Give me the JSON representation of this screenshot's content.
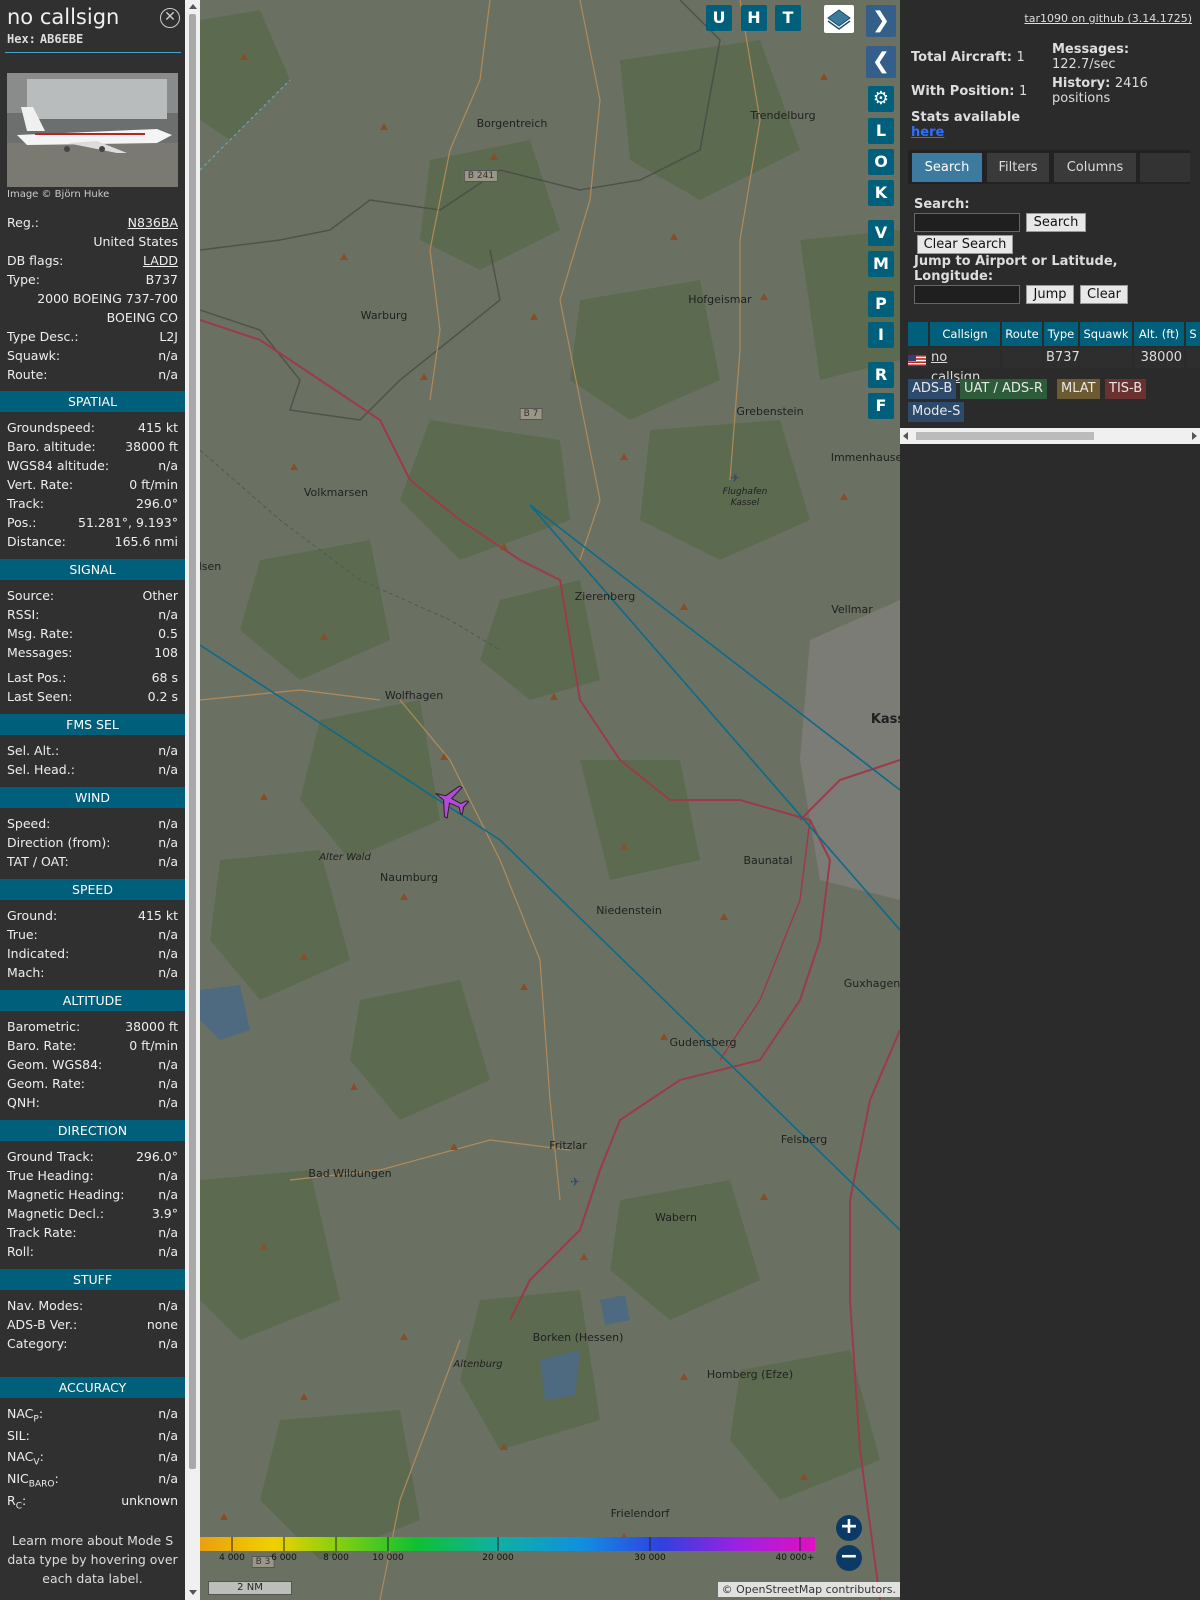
{
  "aircraft": {
    "callsign": "no callsign",
    "hex_label": "Hex:",
    "hex": "AB6EBE",
    "image_credit": "Image © Björn Huke",
    "close_icon": "close-icon"
  },
  "details": {
    "reg_label": "Reg.:",
    "reg": "N836BA",
    "country": "United States",
    "dbflags_label": "DB flags:",
    "dbflags": "LADD",
    "type_label": "Type:",
    "type": "B737",
    "type_full": "2000 BOEING 737-700",
    "manufacturer": "BOEING CO",
    "typedesc_label": "Type Desc.:",
    "typedesc": "L2J",
    "squawk_label": "Squawk:",
    "squawk": "n/a",
    "route_label": "Route:",
    "route": "n/a"
  },
  "sections": {
    "spatial": "SPATIAL",
    "signal": "SIGNAL",
    "fms": "FMS SEL",
    "wind": "WIND",
    "speed": "SPEED",
    "altitude": "ALTITUDE",
    "direction": "DIRECTION",
    "stuff": "STUFF",
    "accuracy": "ACCURACY"
  },
  "spatial": {
    "gs_label": "Groundspeed:",
    "gs": "415 kt",
    "baro_label": "Baro. altitude:",
    "baro": "38000 ft",
    "wgs_label": "WGS84 altitude:",
    "wgs": "n/a",
    "vr_label": "Vert. Rate:",
    "vr": "0 ft/min",
    "track_label": "Track:",
    "track": "296.0°",
    "pos_label": "Pos.:",
    "pos": "51.281°, 9.193°",
    "dist_label": "Distance:",
    "dist": "165.6 nmi"
  },
  "signal": {
    "source_label": "Source:",
    "source": "Other",
    "rssi_label": "RSSI:",
    "rssi": "n/a",
    "msgrate_label": "Msg. Rate:",
    "msgrate": "0.5",
    "messages_label": "Messages:",
    "messages": "108",
    "lastpos_label": "Last Pos.:",
    "lastpos": "68 s",
    "lastseen_label": "Last Seen:",
    "lastseen": "0.2 s"
  },
  "fms": {
    "selalt_label": "Sel. Alt.:",
    "selalt": "n/a",
    "selhead_label": "Sel. Head.:",
    "selhead": "n/a"
  },
  "wind": {
    "speed_label": "Speed:",
    "speed": "n/a",
    "dir_label": "Direction (from):",
    "dir": "n/a",
    "tat_label": "TAT / OAT:",
    "tat": "n/a"
  },
  "speed": {
    "ground_label": "Ground:",
    "ground": "415 kt",
    "true_label": "True:",
    "true": "n/a",
    "ind_label": "Indicated:",
    "ind": "n/a",
    "mach_label": "Mach:",
    "mach": "n/a"
  },
  "altitude": {
    "baro_label": "Barometric:",
    "baro": "38000 ft",
    "rate_label": "Baro. Rate:",
    "rate": "0 ft/min",
    "geom_label": "Geom. WGS84:",
    "geom": "n/a",
    "georate_label": "Geom. Rate:",
    "georate": "n/a",
    "qnh_label": "QNH:",
    "qnh": "n/a"
  },
  "direction": {
    "gt_label": "Ground Track:",
    "gt": "296.0°",
    "th_label": "True Heading:",
    "th": "n/a",
    "mh_label": "Magnetic Heading:",
    "mh": "n/a",
    "md_label": "Magnetic Decl.:",
    "md": "3.9°",
    "tr_label": "Track Rate:",
    "tr": "n/a",
    "roll_label": "Roll:",
    "roll": "n/a"
  },
  "stuff": {
    "nav_label": "Nav. Modes:",
    "nav": "n/a",
    "adsb_label": "ADS-B Ver.:",
    "adsb": "none",
    "cat_label": "Category:",
    "cat": "n/a"
  },
  "accuracy": {
    "nacp_label": "NAC",
    "nacp_sub": "P",
    "nacp": "n/a",
    "sil_label": "SIL:",
    "sil": "n/a",
    "nacv_label": "NAC",
    "nacv_sub": "V",
    "nacv": "n/a",
    "nicb_label": "NIC",
    "nicb_sub": "BARO",
    "nicb": "n/a",
    "rc_label": "R",
    "rc_sub": "C",
    "rc": "unknown"
  },
  "learn_more": "Learn more about Mode S data type by hovering over each data label.",
  "map": {
    "buttons_top": [
      "U",
      "H",
      "T"
    ],
    "buttons_side": [
      "L",
      "O",
      "K",
      "V",
      "M",
      "P",
      "I",
      "R",
      "F"
    ],
    "places": [
      {
        "name": "Borgentreich"
      },
      {
        "name": "Trendelburg"
      },
      {
        "name": "Hofgeismar"
      },
      {
        "name": "Warburg"
      },
      {
        "name": "Grebenstein"
      },
      {
        "name": "Immenhausen"
      },
      {
        "name": "Volkmarsen"
      },
      {
        "name": "Flughafen Kassel"
      },
      {
        "name": "Zierenberg"
      },
      {
        "name": "Vellmar"
      },
      {
        "name": "Kass"
      },
      {
        "name": "Wolfhagen"
      },
      {
        "name": "Alter Wald"
      },
      {
        "name": "Naumburg"
      },
      {
        "name": "Baunatal"
      },
      {
        "name": "Niedenstein"
      },
      {
        "name": "Guxhagen"
      },
      {
        "name": "Gudensberg"
      },
      {
        "name": "Fritzlar"
      },
      {
        "name": "Bad Wildungen"
      },
      {
        "name": "Felsberg"
      },
      {
        "name": "Wabern"
      },
      {
        "name": "Borken (Hessen)"
      },
      {
        "name": "Altenburg"
      },
      {
        "name": "Homberg (Efze)"
      },
      {
        "name": "Frielendorf"
      },
      {
        "name": "lsen"
      }
    ],
    "road_labels": [
      "B 241",
      "B 7",
      "B 3"
    ],
    "colorbar_labels": [
      "4 000",
      "6 000",
      "8 000",
      "10 000",
      "20 000",
      "30 000",
      "40 000+"
    ],
    "scale": "2 NM",
    "attribution_prefix": "© ",
    "attribution_link": "OpenStreetMap",
    "attribution_suffix": " contributors."
  },
  "right_panel": {
    "github_link": "tar1090 on github (3.14.1725)",
    "total_label": "Total Aircraft:",
    "total": "1",
    "withpos_label": "With Position:",
    "withpos": "1",
    "messages_label": "Messages:",
    "messages": "122.7/sec",
    "history_label": "History:",
    "history": "2416 positions",
    "stats_label": "Stats available",
    "stats_link": "here",
    "tabs": [
      "Search",
      "Filters",
      "Columns"
    ],
    "search_label": "Search:",
    "search_btn": "Search",
    "clear_search_btn": "Clear Search",
    "jump_label": "Jump to Airport or Latitude, Longitude:",
    "jump_btn": "Jump",
    "clear_btn": "Clear",
    "table_headers": [
      "Callsign",
      "Route",
      "Type",
      "Squawk",
      "Alt. (ft)",
      "S"
    ],
    "table_row": {
      "callsign": "no callsign",
      "route": "",
      "type": "B737",
      "squawk": "",
      "alt": "38000"
    },
    "badges": [
      "ADS-B",
      "UAT / ADS-R",
      "MLAT",
      "TIS-B",
      "Mode-S"
    ]
  },
  "colors": {
    "accent": "#005f7a",
    "panel_bg": "#303030",
    "map_bg": "#6b7162",
    "aircraft_icon": "#b44ad8"
  }
}
